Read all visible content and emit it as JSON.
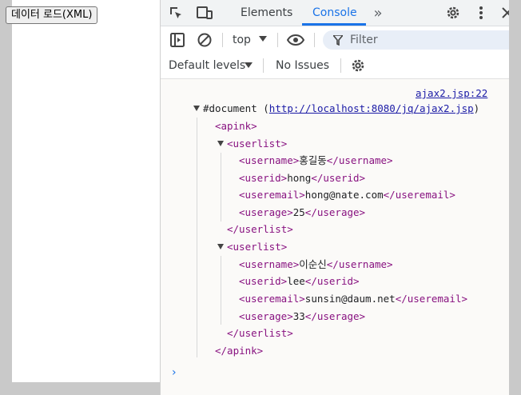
{
  "page": {
    "load_button": "데이터 로드(XML)"
  },
  "devtools": {
    "tabs": {
      "elements": "Elements",
      "console": "Console"
    },
    "toolbar": {
      "context": "top",
      "filter_placeholder": "Filter",
      "levels": "Default levels",
      "issues": "No Issues"
    },
    "console": {
      "source_link": "ajax2.jsp:22",
      "doc_label": "#document",
      "doc_paren_open": "(",
      "doc_url": "http://localhost:8080/jq/ajax2.jsp",
      "doc_paren_close": ")",
      "apink_open": "<apink>",
      "apink_close": "</apink>",
      "users": [
        {
          "open": "<userlist>",
          "close": "</userlist>",
          "fields": [
            {
              "otag": "<username>",
              "value": "홍길동",
              "ctag": "</username>"
            },
            {
              "otag": "<userid>",
              "value": "hong",
              "ctag": "</userid>"
            },
            {
              "otag": "<useremail>",
              "value": "hong@nate.com",
              "ctag": "</useremail>"
            },
            {
              "otag": "<userage>",
              "value": "25",
              "ctag": "</userage>"
            }
          ]
        },
        {
          "open": "<userlist>",
          "close": "</userlist>",
          "fields": [
            {
              "otag": "<username>",
              "value": "이순신",
              "ctag": "</username>"
            },
            {
              "otag": "<userid>",
              "value": "lee",
              "ctag": "</userid>"
            },
            {
              "otag": "<useremail>",
              "value": "sunsin@daum.net",
              "ctag": "</useremail>"
            },
            {
              "otag": "<userage>",
              "value": "33",
              "ctag": "</userage>"
            }
          ]
        }
      ],
      "prompt": "›"
    }
  }
}
